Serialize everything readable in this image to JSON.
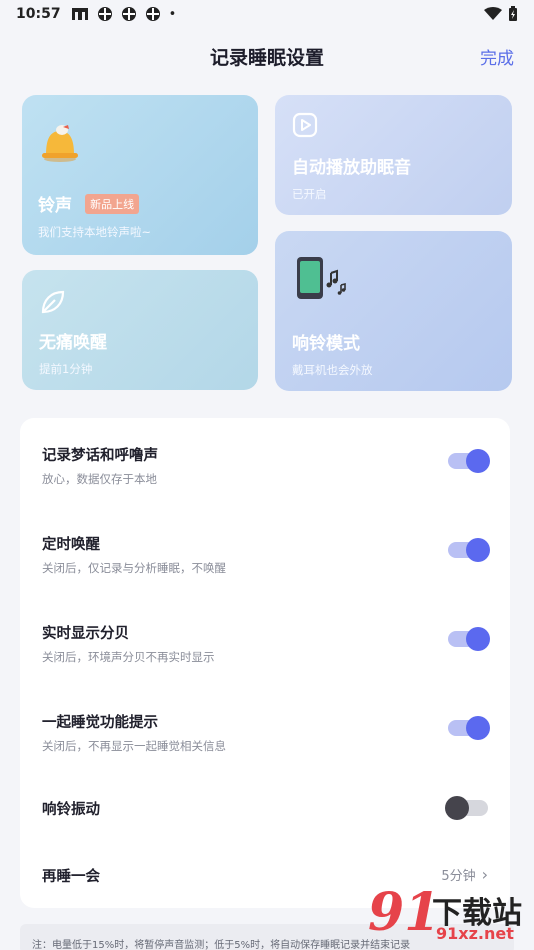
{
  "status_bar": {
    "time": "10:57",
    "dot": "•"
  },
  "header": {
    "title": "记录睡眠设置",
    "done": "完成"
  },
  "cards": {
    "ring": {
      "title": "铃声",
      "badge": "新品上线",
      "sub": "我们支持本地铃声啦~"
    },
    "autoplay": {
      "title": "自动播放助眠音",
      "sub": "已开启"
    },
    "gentle": {
      "title": "无痛唤醒",
      "sub": "提前1分钟"
    },
    "mode": {
      "title": "响铃模式",
      "sub": "戴耳机也会外放"
    }
  },
  "settings": [
    {
      "label": "记录梦话和呼噜声",
      "desc": "放心，数据仅存于本地",
      "toggle": "on"
    },
    {
      "label": "定时唤醒",
      "desc": "关闭后，仅记录与分析睡眠，不唤醒",
      "toggle": "on"
    },
    {
      "label": "实时显示分贝",
      "desc": "关闭后，环境声分贝不再实时显示",
      "toggle": "on"
    },
    {
      "label": "一起睡觉功能提示",
      "desc": "关闭后，不再显示一起睡觉相关信息",
      "toggle": "on"
    },
    {
      "label": "响铃振动",
      "toggle": "off"
    },
    {
      "label": "再睡一会",
      "value": "5分钟",
      "chevron": "›"
    }
  ],
  "footer": {
    "note": "注：电量低于15%时，将暂停声音监测；低于5%时，将自动保存睡眠记录并结束记录"
  },
  "watermark": {
    "big": "91",
    "text": "下载站",
    "url": "91xz.net"
  },
  "colors": {
    "accent": "#5b69ef",
    "done": "#5a6ee8",
    "badge": "#f2a58f"
  }
}
